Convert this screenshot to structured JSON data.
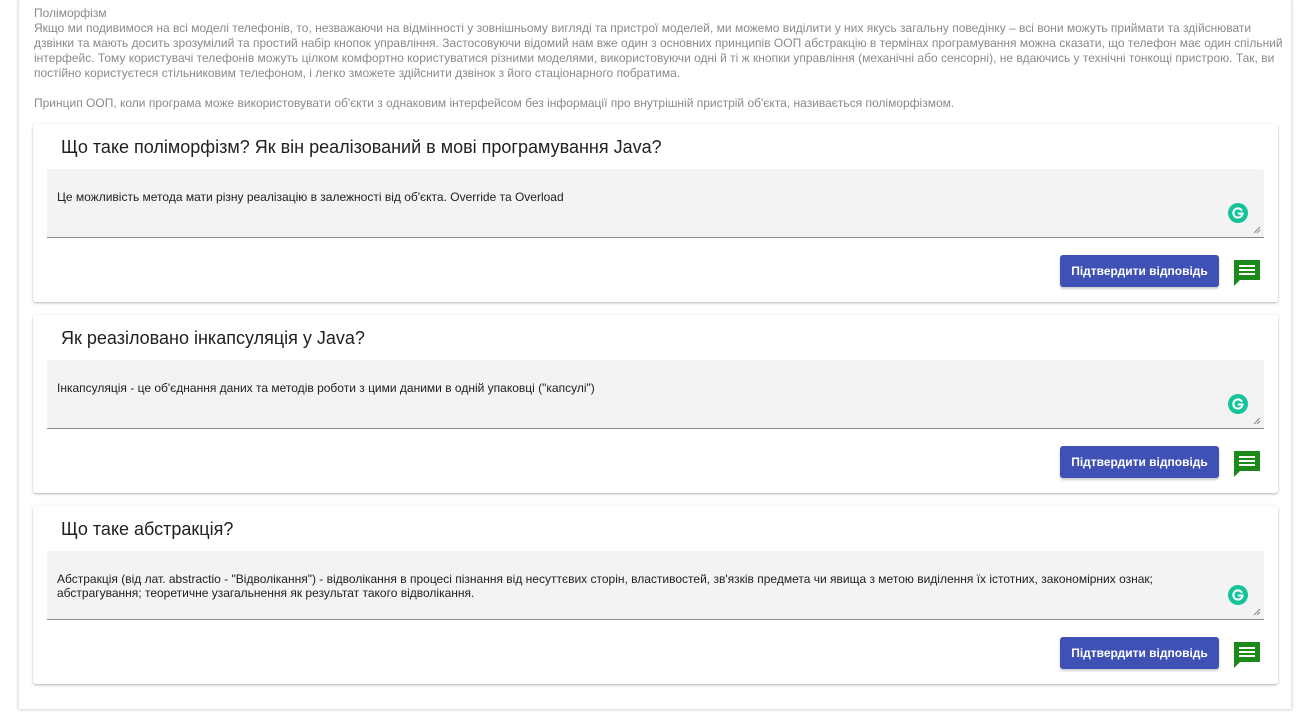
{
  "intro": {
    "title": "Поліморфізм",
    "body": "Якщо ми подивимося на всі моделі телефонів, то, незважаючи на відмінності у зовнішньому вигляді та пристрої моделей, ми можемо виділити у них якусь загальну поведінку – всі вони можуть приймати та здійснювати дзвінки та мають досить зрозумілий та простий набір кнопок управління. Застосовуючи відомий нам вже один з основних принципів ООП абстракцію в термінах програмування можна сказати, що телефон має один спільний інтерфейс. Тому користувачі телефонів можуть цілком комфортно користуватися різними моделями, використовуючи одні й ті ж кнопки управління (механічні або сенсорні), не вдаючись у технічні тонкощі пристрою. Так, ви постійно користуєтеся стільниковим телефоном, і легко зможете здійснити дзвінок з його стаціонарного побратима.",
    "definition": "Принцип ООП, коли програма може використовувати об'єкти з однаковим інтерфейсом без інформації про внутрішній пристрій об'єкта, називається поліморфізмом."
  },
  "questions": [
    {
      "title": "Що таке поліморфізм? Як він реалізований в мові програмування Java?",
      "answer": "Це можливість метода мати різну реалізацію в залежності від об'єкта. Override та Overload",
      "submit_label": "Підтвердити відповідь",
      "comment_icon": "comment-icon"
    },
    {
      "title": "Як реазіловано інкапсуляція у Java?",
      "answer": "Інкапсуляція - це об'єднання даних та методів роботи з цими даними в одній упаковці (\"капсулі\")",
      "submit_label": "Підтвердити відповідь",
      "comment_icon": "comment-icon"
    },
    {
      "title": "Що таке абстракція?",
      "answer": "Абстракція (від лат. abstractio - \"Відволікання\") - відволікання в процесі пізнання від несуттєвих сторін, властивостей, зв'язків предмета чи явища з метою виділення їх істотних, закономірних ознак; абстрагування; теоретичне узагальнення як результат такого відволікання.",
      "submit_label": "Підтвердити відповідь",
      "comment_icon": "comment-icon"
    }
  ],
  "colors": {
    "primary_button": "#3f51b5",
    "comment_icon": "#1b8a1b",
    "grammarly": "#15c39a"
  }
}
